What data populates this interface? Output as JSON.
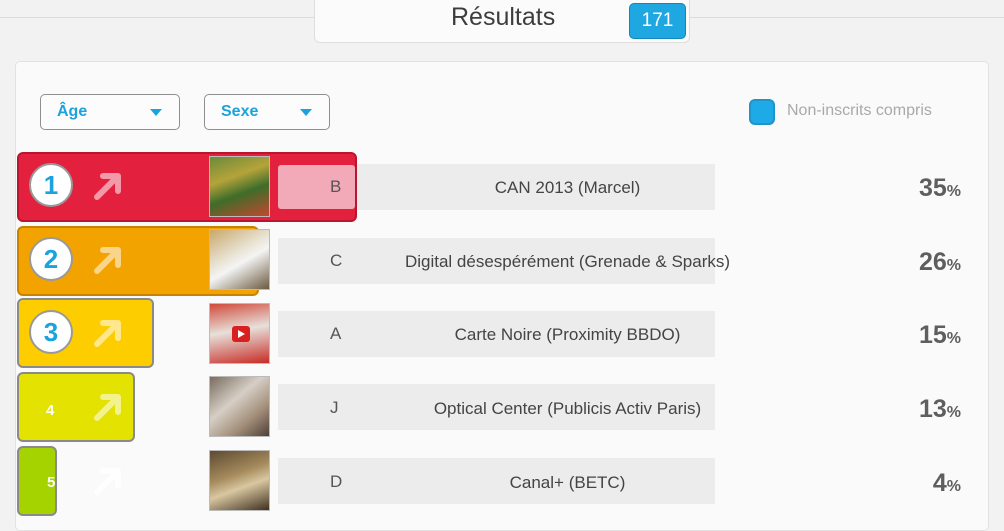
{
  "header": {
    "title": "Résultats",
    "count": "171"
  },
  "filters": {
    "age": "Âge",
    "sexe": "Sexe"
  },
  "checkbox": {
    "label": "Non-inscrits compris",
    "checked": true
  },
  "results": [
    {
      "rank": "1",
      "letter": "B",
      "name": "CAN 2013 (Marcel)",
      "percent": "35",
      "unit": "%",
      "color": "#e3213e"
    },
    {
      "rank": "2",
      "letter": "C",
      "name": "Digital désespérément (Grenade & Sparks)",
      "percent": "26",
      "unit": "%",
      "color": "#f2a300"
    },
    {
      "rank": "3",
      "letter": "A",
      "name": "Carte Noire (Proximity BBDO)",
      "percent": "15",
      "unit": "%",
      "color": "#fecd00"
    },
    {
      "rank": "4",
      "letter": "J",
      "name": "Optical Center (Publicis Activ Paris)",
      "percent": "13",
      "unit": "%",
      "color": "#e4e200"
    },
    {
      "rank": "5",
      "letter": "D",
      "name": "Canal+ (BETC)",
      "percent": "4",
      "unit": "%",
      "color": "#a5d300"
    }
  ]
}
